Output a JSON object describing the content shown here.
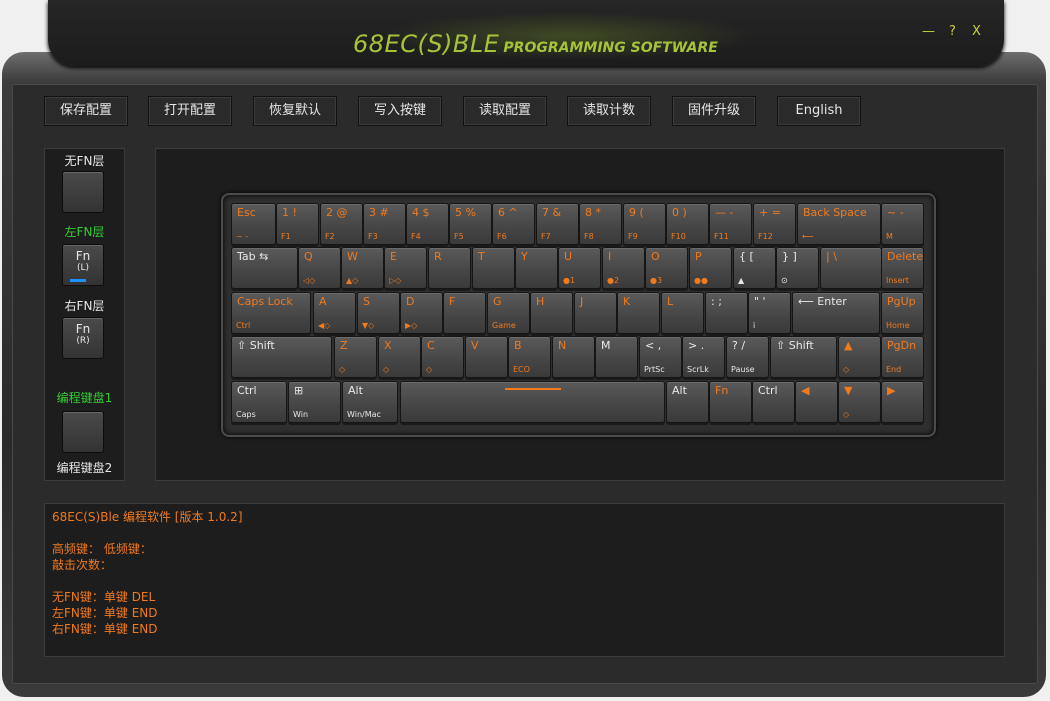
{
  "app": {
    "title_main": "68EC(S)BLE",
    "title_sub": "PROGRAMMING SOFTWARE",
    "minimize": "—",
    "help": "?",
    "close": "X"
  },
  "toolbar": {
    "save": "保存配置",
    "open": "打开配置",
    "restore": "恢复默认",
    "write": "写入按键",
    "read": "读取配置",
    "count": "读取计数",
    "firmware": "固件升级",
    "language": "English"
  },
  "sidebar": {
    "no_fn_label": "无FN层",
    "left_fn_label": "左FN层",
    "left_fn_btn": "Fn",
    "left_fn_sub": "(L)",
    "right_fn_label": "右FN层",
    "right_fn_btn": "Fn",
    "right_fn_sub": "(R)",
    "prog1_label": "编程键盘1",
    "prog2_label": "编程键盘2"
  },
  "keyboard": {
    "rows": [
      [
        {
          "t": "Esc",
          "b": "~ -",
          "o": true
        },
        {
          "t": "1 !",
          "b": "F1",
          "o": true
        },
        {
          "t": "2 @",
          "b": "F2",
          "o": true
        },
        {
          "t": "3 #",
          "b": "F3",
          "o": true
        },
        {
          "t": "4 $",
          "b": "F4",
          "o": true
        },
        {
          "t": "5 %",
          "b": "F5",
          "o": true
        },
        {
          "t": "6 ^",
          "b": "F6",
          "o": true
        },
        {
          "t": "7 &",
          "b": "F7",
          "o": true
        },
        {
          "t": "8 *",
          "b": "F8",
          "o": true
        },
        {
          "t": "9 (",
          "b": "F9",
          "o": true
        },
        {
          "t": "0 )",
          "b": "F10",
          "o": true
        },
        {
          "t": "— -",
          "b": "F11",
          "o": true
        },
        {
          "t": "+ =",
          "b": "F12",
          "o": true
        },
        {
          "t": "Back Space",
          "b": "⟵",
          "o": true
        },
        {
          "t": "~ -",
          "b": "M",
          "o": true
        }
      ],
      [
        {
          "t": "Tab ⇆",
          "b": "",
          "o": false
        },
        {
          "t": "Q",
          "b": "◁◇",
          "o": true
        },
        {
          "t": "W",
          "b": "▲◇",
          "o": true
        },
        {
          "t": "E",
          "b": "▷◇",
          "o": true
        },
        {
          "t": "R",
          "b": "",
          "o": true
        },
        {
          "t": "T",
          "b": "",
          "o": true
        },
        {
          "t": "Y",
          "b": "",
          "o": true
        },
        {
          "t": "U",
          "b": "●1",
          "o": true
        },
        {
          "t": "I",
          "b": "●2",
          "o": true
        },
        {
          "t": "O",
          "b": "●3",
          "o": true
        },
        {
          "t": "P",
          "b": "●●",
          "o": true
        },
        {
          "t": "{ [",
          "b": "▲",
          "o": false
        },
        {
          "t": "} ]",
          "b": "⊙",
          "o": false
        },
        {
          "t": "| \\",
          "b": "",
          "o": true
        },
        {
          "t": "Delete",
          "b": "Insert",
          "o": true
        }
      ],
      [
        {
          "t": "Caps Lock",
          "b": "Ctrl",
          "o": true
        },
        {
          "t": "A",
          "b": "◀◇",
          "o": true
        },
        {
          "t": "S",
          "b": "▼◇",
          "o": true
        },
        {
          "t": "D",
          "b": "▶◇",
          "o": true
        },
        {
          "t": "F",
          "b": "",
          "o": true
        },
        {
          "t": "G",
          "b": "Game",
          "o": true
        },
        {
          "t": "H",
          "b": "",
          "o": true
        },
        {
          "t": "J",
          "b": "",
          "o": true
        },
        {
          "t": "K",
          "b": "",
          "o": true
        },
        {
          "t": "L",
          "b": "",
          "o": true
        },
        {
          "t": ": ;",
          "b": "",
          "o": false
        },
        {
          "t": "\" '",
          "b": "i",
          "o": false
        },
        {
          "t": "⟵ Enter",
          "b": "",
          "o": false
        },
        {
          "t": "PgUp",
          "b": "Home",
          "o": true
        }
      ],
      [
        {
          "t": "⇧ Shift",
          "b": "",
          "o": false
        },
        {
          "t": "Z",
          "b": "◇",
          "o": true
        },
        {
          "t": "X",
          "b": "◇",
          "o": true
        },
        {
          "t": "C",
          "b": "◇",
          "o": true
        },
        {
          "t": "V",
          "b": "",
          "o": true
        },
        {
          "t": "B",
          "b": "ECO",
          "o": true
        },
        {
          "t": "N",
          "b": "",
          "o": true
        },
        {
          "t": "M",
          "b": "",
          "o": false
        },
        {
          "t": "< ,",
          "b": "PrtSc",
          "o": false
        },
        {
          "t": "> .",
          "b": "ScrLk",
          "o": false
        },
        {
          "t": "? /",
          "b": "Pause",
          "o": false
        },
        {
          "t": "⇧ Shift",
          "b": "",
          "o": false
        },
        {
          "t": "▲",
          "b": "◇",
          "o": true
        },
        {
          "t": "PgDn",
          "b": "End",
          "o": true
        }
      ],
      [
        {
          "t": "Ctrl",
          "b": "Caps",
          "o": false
        },
        {
          "t": "⊞",
          "b": "Win",
          "o": false
        },
        {
          "t": "Alt",
          "b": "Win/Mac",
          "o": false
        },
        {
          "t": "",
          "b": "",
          "o": false
        },
        {
          "t": "Alt",
          "b": "",
          "o": false
        },
        {
          "t": "Fn",
          "b": "",
          "o": true
        },
        {
          "t": "Ctrl",
          "b": "",
          "o": false
        },
        {
          "t": "◀",
          "b": "",
          "o": true
        },
        {
          "t": "▼",
          "b": "◇",
          "o": true
        },
        {
          "t": "▶",
          "b": "",
          "o": true
        }
      ]
    ]
  },
  "console": {
    "lines": [
      "68EC(S)Ble 编程软件 [版本 1.0.2]",
      "",
      "高频键：     低频键：",
      "敲击次数：",
      "",
      "无FN键：单键 DEL",
      "左FN键：单键 END",
      "右FN键：单键 END"
    ]
  },
  "colors": {
    "accent_orange": "#f07a1e",
    "title_green": "#a6c43a",
    "fn_green": "#33cc33",
    "fn_indicator_blue": "#1e90ff"
  }
}
